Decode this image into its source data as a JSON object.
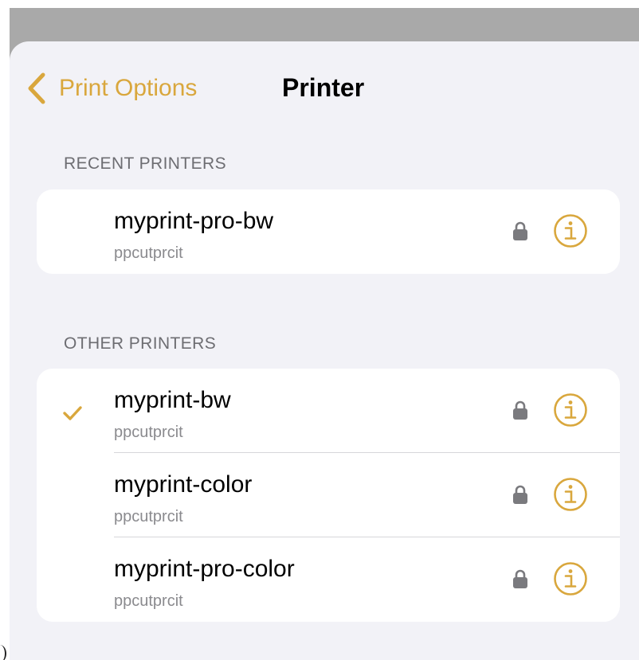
{
  "colors": {
    "accent": "#d9a73d",
    "sheet_background": "#f2f2f7",
    "dimmed_backdrop": "#a9a9a9",
    "secondary_text": "#8a8a8e",
    "lock": "#7a7a7e"
  },
  "nav": {
    "back_label": "Print Options",
    "back_icon": "chevron-left-icon",
    "title": "Printer"
  },
  "sections": {
    "recent": {
      "header": "RECENT PRINTERS",
      "printers": [
        {
          "name": "myprint-pro-bw",
          "host": "ppcutprcit",
          "selected": false,
          "locked": true
        }
      ]
    },
    "other": {
      "header": "OTHER PRINTERS",
      "printers": [
        {
          "name": "myprint-bw",
          "host": "ppcutprcit",
          "selected": true,
          "locked": true
        },
        {
          "name": "myprint-color",
          "host": "ppcutprcit",
          "selected": false,
          "locked": true
        },
        {
          "name": "myprint-pro-color",
          "host": "ppcutprcit",
          "selected": false,
          "locked": true
        }
      ]
    }
  },
  "icons": {
    "selected": "checkmark-icon",
    "locked": "lock-icon",
    "details": "info-icon"
  }
}
